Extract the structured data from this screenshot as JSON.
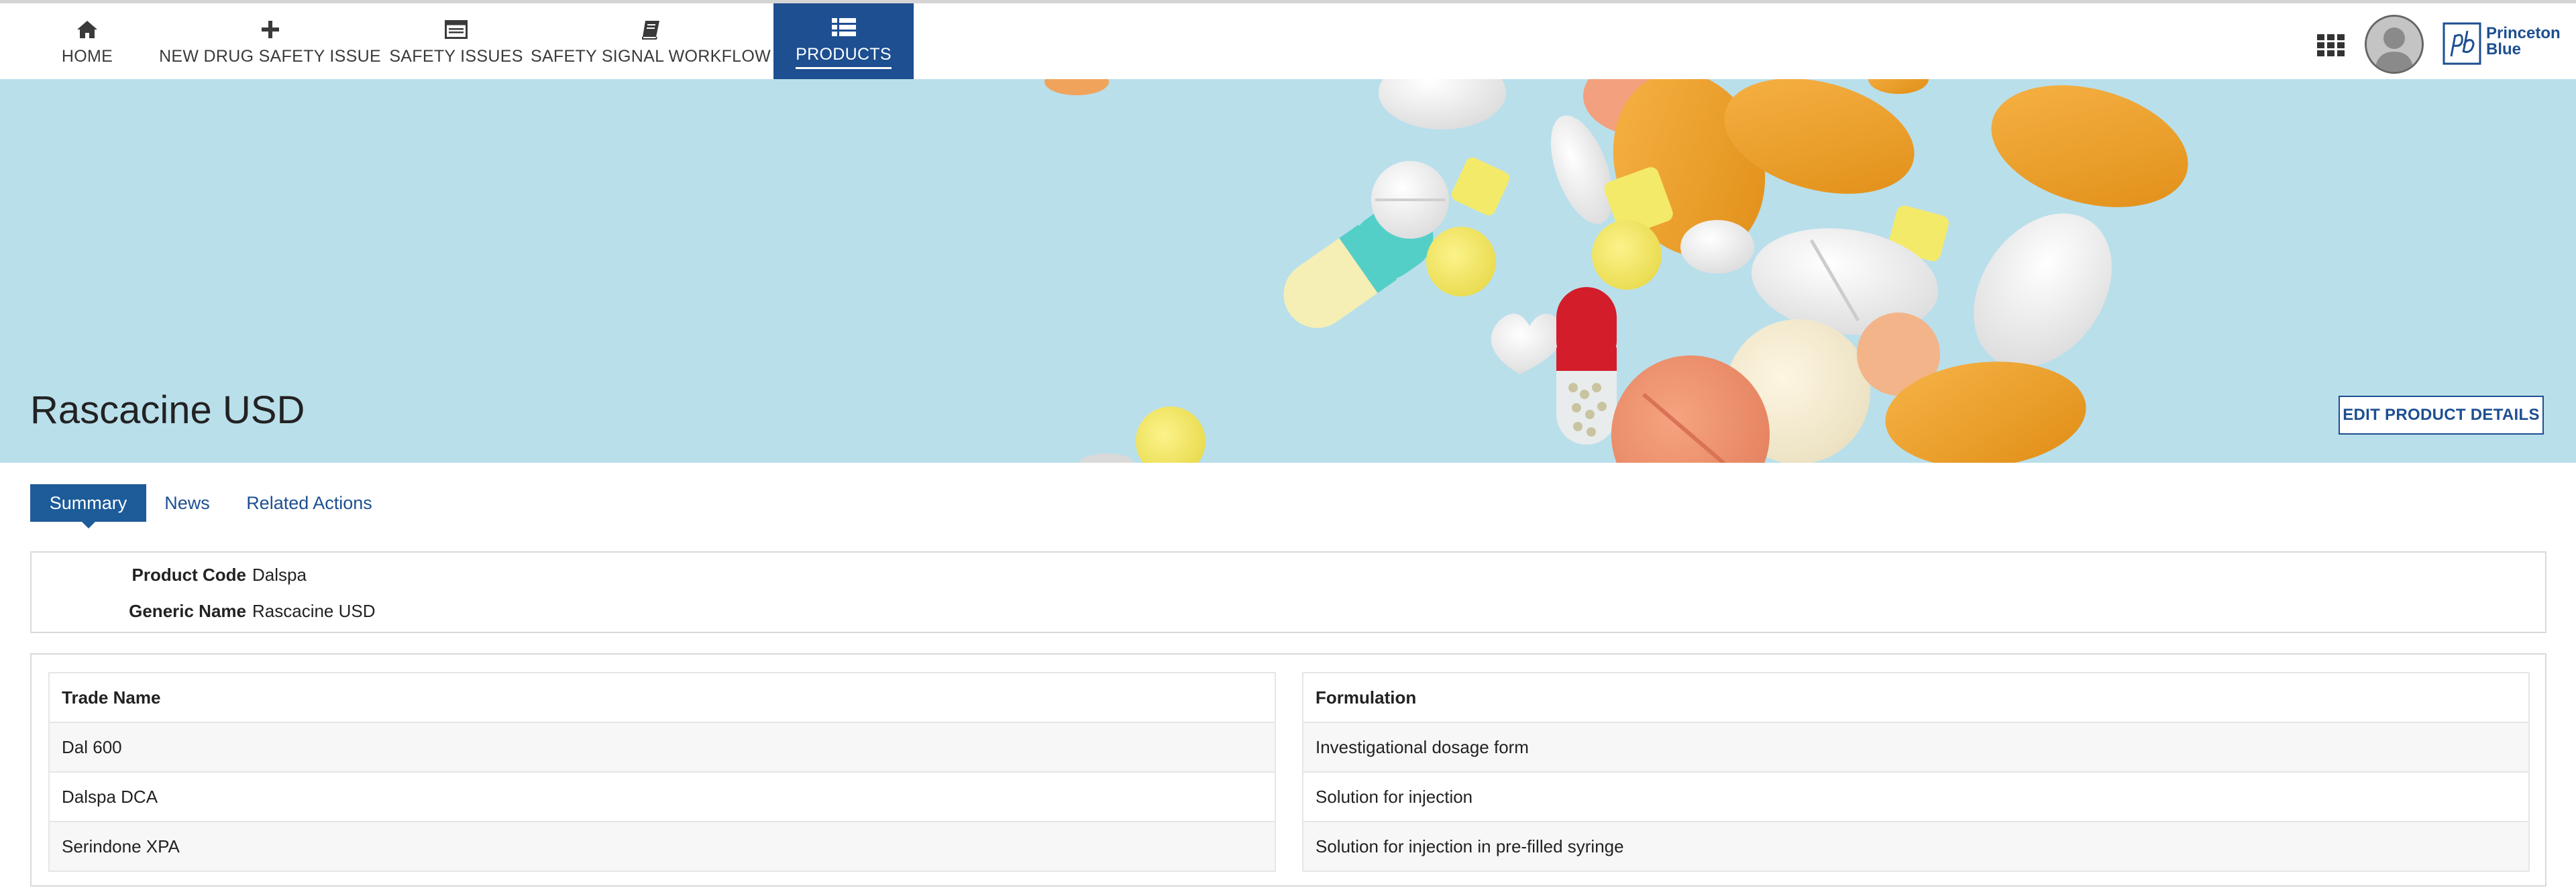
{
  "nav": {
    "items": [
      {
        "label": "HOME",
        "icon": "home-icon"
      },
      {
        "label": "NEW DRUG SAFETY ISSUE",
        "icon": "plus-icon"
      },
      {
        "label": "SAFETY ISSUES",
        "icon": "list-window-icon"
      },
      {
        "label": "SAFETY SIGNAL WORKFLOW",
        "icon": "book-icon"
      },
      {
        "label": "PRODUCTS",
        "icon": "table-list-icon"
      }
    ],
    "active": "PRODUCTS",
    "accent_color": "#1d4f91"
  },
  "brand": {
    "line1": "Princeton",
    "line2": "Blue"
  },
  "product": {
    "title": "Rascacine USD",
    "edit_button": "EDIT PRODUCT DETAILS"
  },
  "tabs": [
    {
      "label": "Summary",
      "active": true
    },
    {
      "label": "News",
      "active": false
    },
    {
      "label": "Related Actions",
      "active": false
    }
  ],
  "summary": {
    "fields": [
      {
        "key": "Product Code",
        "value": "Dalspa"
      },
      {
        "key": "Generic Name",
        "value": "Rascacine USD"
      }
    ]
  },
  "trade_table": {
    "header": "Trade Name",
    "rows": [
      "Dal 600",
      "Dalspa DCA",
      "Serindone XPA"
    ]
  },
  "formulation_table": {
    "header": "Formulation",
    "rows": [
      "Investigational dosage form",
      "Solution for injection",
      "Solution for injection in pre-filled syringe"
    ]
  }
}
